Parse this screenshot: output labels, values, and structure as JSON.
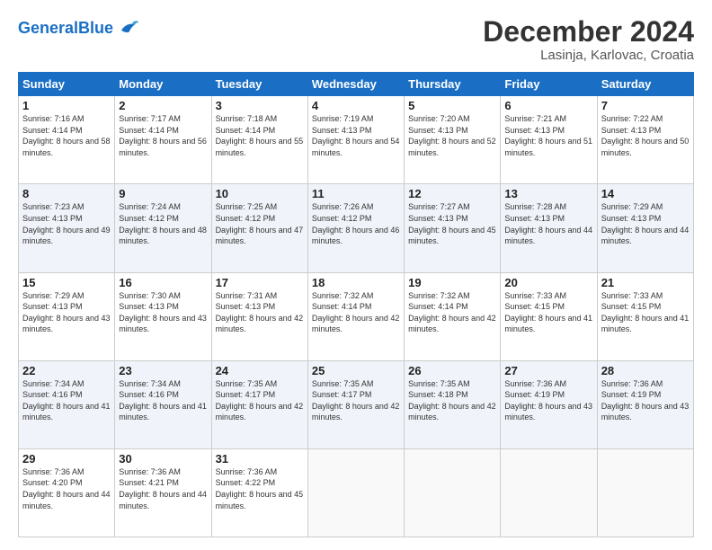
{
  "logo": {
    "text_general": "General",
    "text_blue": "Blue"
  },
  "title": "December 2024",
  "subtitle": "Lasinja, Karlovac, Croatia",
  "header_days": [
    "Sunday",
    "Monday",
    "Tuesday",
    "Wednesday",
    "Thursday",
    "Friday",
    "Saturday"
  ],
  "weeks": [
    [
      {
        "day": "1",
        "sunrise": "Sunrise: 7:16 AM",
        "sunset": "Sunset: 4:14 PM",
        "daylight": "Daylight: 8 hours and 58 minutes."
      },
      {
        "day": "2",
        "sunrise": "Sunrise: 7:17 AM",
        "sunset": "Sunset: 4:14 PM",
        "daylight": "Daylight: 8 hours and 56 minutes."
      },
      {
        "day": "3",
        "sunrise": "Sunrise: 7:18 AM",
        "sunset": "Sunset: 4:14 PM",
        "daylight": "Daylight: 8 hours and 55 minutes."
      },
      {
        "day": "4",
        "sunrise": "Sunrise: 7:19 AM",
        "sunset": "Sunset: 4:13 PM",
        "daylight": "Daylight: 8 hours and 54 minutes."
      },
      {
        "day": "5",
        "sunrise": "Sunrise: 7:20 AM",
        "sunset": "Sunset: 4:13 PM",
        "daylight": "Daylight: 8 hours and 52 minutes."
      },
      {
        "day": "6",
        "sunrise": "Sunrise: 7:21 AM",
        "sunset": "Sunset: 4:13 PM",
        "daylight": "Daylight: 8 hours and 51 minutes."
      },
      {
        "day": "7",
        "sunrise": "Sunrise: 7:22 AM",
        "sunset": "Sunset: 4:13 PM",
        "daylight": "Daylight: 8 hours and 50 minutes."
      }
    ],
    [
      {
        "day": "8",
        "sunrise": "Sunrise: 7:23 AM",
        "sunset": "Sunset: 4:13 PM",
        "daylight": "Daylight: 8 hours and 49 minutes."
      },
      {
        "day": "9",
        "sunrise": "Sunrise: 7:24 AM",
        "sunset": "Sunset: 4:12 PM",
        "daylight": "Daylight: 8 hours and 48 minutes."
      },
      {
        "day": "10",
        "sunrise": "Sunrise: 7:25 AM",
        "sunset": "Sunset: 4:12 PM",
        "daylight": "Daylight: 8 hours and 47 minutes."
      },
      {
        "day": "11",
        "sunrise": "Sunrise: 7:26 AM",
        "sunset": "Sunset: 4:12 PM",
        "daylight": "Daylight: 8 hours and 46 minutes."
      },
      {
        "day": "12",
        "sunrise": "Sunrise: 7:27 AM",
        "sunset": "Sunset: 4:13 PM",
        "daylight": "Daylight: 8 hours and 45 minutes."
      },
      {
        "day": "13",
        "sunrise": "Sunrise: 7:28 AM",
        "sunset": "Sunset: 4:13 PM",
        "daylight": "Daylight: 8 hours and 44 minutes."
      },
      {
        "day": "14",
        "sunrise": "Sunrise: 7:29 AM",
        "sunset": "Sunset: 4:13 PM",
        "daylight": "Daylight: 8 hours and 44 minutes."
      }
    ],
    [
      {
        "day": "15",
        "sunrise": "Sunrise: 7:29 AM",
        "sunset": "Sunset: 4:13 PM",
        "daylight": "Daylight: 8 hours and 43 minutes."
      },
      {
        "day": "16",
        "sunrise": "Sunrise: 7:30 AM",
        "sunset": "Sunset: 4:13 PM",
        "daylight": "Daylight: 8 hours and 43 minutes."
      },
      {
        "day": "17",
        "sunrise": "Sunrise: 7:31 AM",
        "sunset": "Sunset: 4:13 PM",
        "daylight": "Daylight: 8 hours and 42 minutes."
      },
      {
        "day": "18",
        "sunrise": "Sunrise: 7:32 AM",
        "sunset": "Sunset: 4:14 PM",
        "daylight": "Daylight: 8 hours and 42 minutes."
      },
      {
        "day": "19",
        "sunrise": "Sunrise: 7:32 AM",
        "sunset": "Sunset: 4:14 PM",
        "daylight": "Daylight: 8 hours and 42 minutes."
      },
      {
        "day": "20",
        "sunrise": "Sunrise: 7:33 AM",
        "sunset": "Sunset: 4:15 PM",
        "daylight": "Daylight: 8 hours and 41 minutes."
      },
      {
        "day": "21",
        "sunrise": "Sunrise: 7:33 AM",
        "sunset": "Sunset: 4:15 PM",
        "daylight": "Daylight: 8 hours and 41 minutes."
      }
    ],
    [
      {
        "day": "22",
        "sunrise": "Sunrise: 7:34 AM",
        "sunset": "Sunset: 4:16 PM",
        "daylight": "Daylight: 8 hours and 41 minutes."
      },
      {
        "day": "23",
        "sunrise": "Sunrise: 7:34 AM",
        "sunset": "Sunset: 4:16 PM",
        "daylight": "Daylight: 8 hours and 41 minutes."
      },
      {
        "day": "24",
        "sunrise": "Sunrise: 7:35 AM",
        "sunset": "Sunset: 4:17 PM",
        "daylight": "Daylight: 8 hours and 42 minutes."
      },
      {
        "day": "25",
        "sunrise": "Sunrise: 7:35 AM",
        "sunset": "Sunset: 4:17 PM",
        "daylight": "Daylight: 8 hours and 42 minutes."
      },
      {
        "day": "26",
        "sunrise": "Sunrise: 7:35 AM",
        "sunset": "Sunset: 4:18 PM",
        "daylight": "Daylight: 8 hours and 42 minutes."
      },
      {
        "day": "27",
        "sunrise": "Sunrise: 7:36 AM",
        "sunset": "Sunset: 4:19 PM",
        "daylight": "Daylight: 8 hours and 43 minutes."
      },
      {
        "day": "28",
        "sunrise": "Sunrise: 7:36 AM",
        "sunset": "Sunset: 4:19 PM",
        "daylight": "Daylight: 8 hours and 43 minutes."
      }
    ],
    [
      {
        "day": "29",
        "sunrise": "Sunrise: 7:36 AM",
        "sunset": "Sunset: 4:20 PM",
        "daylight": "Daylight: 8 hours and 44 minutes."
      },
      {
        "day": "30",
        "sunrise": "Sunrise: 7:36 AM",
        "sunset": "Sunset: 4:21 PM",
        "daylight": "Daylight: 8 hours and 44 minutes."
      },
      {
        "day": "31",
        "sunrise": "Sunrise: 7:36 AM",
        "sunset": "Sunset: 4:22 PM",
        "daylight": "Daylight: 8 hours and 45 minutes."
      },
      null,
      null,
      null,
      null
    ]
  ]
}
